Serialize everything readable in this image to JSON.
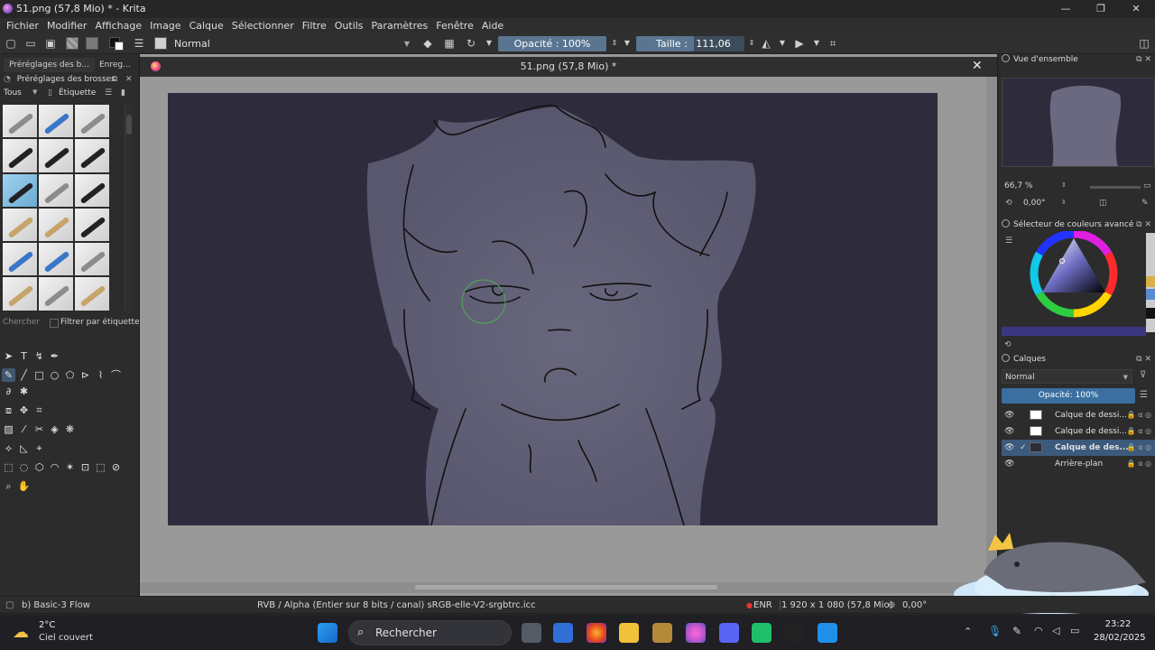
{
  "window": {
    "title": "51.png (57,8 Mio) * - Krita"
  },
  "menu": [
    "Fichier",
    "Modifier",
    "Affichage",
    "Image",
    "Calque",
    "Sélectionner",
    "Filtre",
    "Outils",
    "Paramètres",
    "Fenêtre",
    "Aide"
  ],
  "toolbar": {
    "blend_mode": "Normal",
    "opacity_label": "Opacité : 100%",
    "opacity_value": 1.0,
    "size_label": "Taille :",
    "size_value_text": "111,06 px",
    "size_fill_fraction": 0.53
  },
  "left_dock": {
    "tabs": [
      "Préréglages des b...",
      "Enreg..."
    ],
    "brush_header": "Préréglages des brosses",
    "filter_all": "Tous",
    "filter_tag": "Étiquette",
    "search_placeholder": "Chercher",
    "filter_by_tag": "Filtrer par étiquette"
  },
  "document": {
    "tab_title": "51.png (57,8 Mio) *"
  },
  "right_dock": {
    "overview_title": "Vue d'ensemble",
    "zoom": "66,7 %",
    "rotation": "0,00°",
    "color_selector_title": "Sélecteur de couleurs avancé",
    "layers_title": "Calques",
    "layer_blend": "Normal",
    "layer_opacity": "Opacité:  100%",
    "layers": [
      {
        "name": "Calque de dessi...",
        "selected": false,
        "thumb": "light"
      },
      {
        "name": "Calque de dessi...",
        "selected": false,
        "thumb": "light"
      },
      {
        "name": "Calque de des...",
        "selected": true,
        "thumb": "dark"
      },
      {
        "name": "Arrière-plan",
        "selected": false,
        "thumb": "none"
      }
    ]
  },
  "status": {
    "brush": "b) Basic-3 Flow",
    "color_space": "RVB / Alpha (Entier sur 8 bits / canal)  sRGB-elle-V2-srgbtrc.icc",
    "rec": "ENR",
    "dimensions": "1 920 x 1 080 (57,8 Mio)",
    "rotation": "0,00°"
  },
  "taskbar": {
    "weather_temp": "2°C",
    "weather_desc": "Ciel couvert",
    "search": "Rechercher",
    "time": "23:22",
    "date": "28/02/2025"
  },
  "colors": {
    "canvas_bg": "#2e2c3c",
    "accent": "#5a7590",
    "selected_layer": "#3b5a7c"
  }
}
